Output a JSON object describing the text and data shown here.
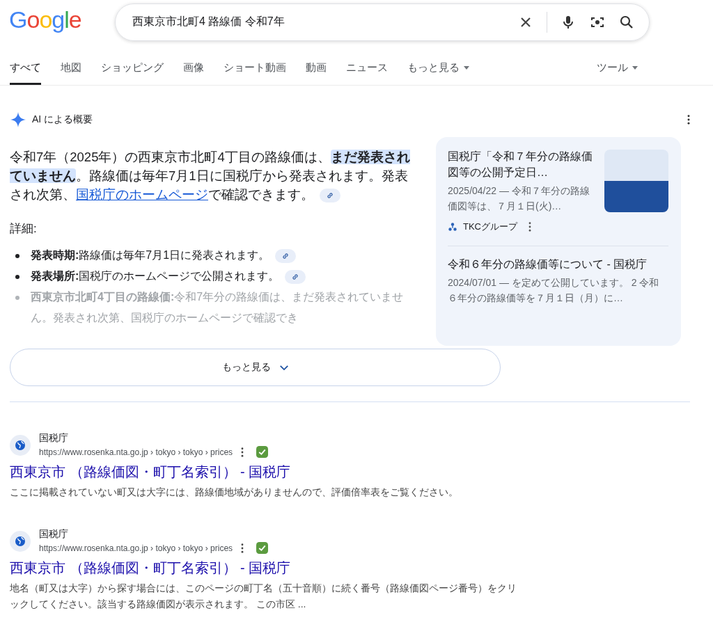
{
  "logo": "Google",
  "search": {
    "value": "西東京市北町4 路線価 令和7年"
  },
  "tabs": [
    {
      "label": "すべて",
      "selected": true,
      "dropdown": false
    },
    {
      "label": "地図",
      "selected": false,
      "dropdown": false
    },
    {
      "label": "ショッピング",
      "selected": false,
      "dropdown": false
    },
    {
      "label": "画像",
      "selected": false,
      "dropdown": false
    },
    {
      "label": "ショート動画",
      "selected": false,
      "dropdown": false
    },
    {
      "label": "動画",
      "selected": false,
      "dropdown": false
    },
    {
      "label": "ニュース",
      "selected": false,
      "dropdown": false
    },
    {
      "label": "もっと見る",
      "selected": false,
      "dropdown": true
    }
  ],
  "tools": {
    "label": "ツール"
  },
  "ai_overview": {
    "title": "AI による概要",
    "paragraph": [
      {
        "kind": "plain",
        "text": "令和7年（2025年）の西東京市北町4丁目の路線価は、"
      },
      {
        "kind": "highlight",
        "text": "まだ発表されていません"
      },
      {
        "kind": "plain",
        "text": "。路線価は毎年7月1日に国税庁から発表されます。発表され次第、"
      },
      {
        "kind": "link",
        "text": "国税庁のホームページ"
      },
      {
        "kind": "plain",
        "text": "で確認できます。"
      }
    ],
    "details_heading": "詳細:",
    "bullets": [
      {
        "label": "発表時期:",
        "text": "路線価は毎年7月1日に発表されます。",
        "faded": false
      },
      {
        "label": "発表場所:",
        "text": "国税庁のホームページで公開されます。",
        "faded": false
      },
      {
        "label": "西東京市北町4丁目の路線価:",
        "text": "令和7年分の路線価は、まだ発表されていません。発表され次第、国税庁のホームページで確認でき",
        "faded": true
      }
    ],
    "sources": [
      {
        "title": "国税庁「令和７年分の路線価図等の公開予定日…",
        "snippet": "2025/04/22 — 令和７年分の路線価図等は、７月１日(火)…",
        "site": "TKCグループ",
        "thumbnail": true
      },
      {
        "title": "令和６年分の路線価等について - 国税庁",
        "snippet": "2024/07/01 — を定めて公開しています。 2 令和６年分の路線価等を７月１日（月）に…",
        "thumbnail": false
      }
    ],
    "more_button": "もっと見る"
  },
  "results": [
    {
      "site": "国税庁",
      "url": "https://www.rosenka.nta.go.jp › tokyo › tokyo › prices",
      "title": "西東京市 （路線価図・町丁名索引） - 国税庁",
      "snippet": "ここに掲載されていない町又は大字には、路線価地域がありませんので、評価倍率表をご覧ください。"
    },
    {
      "site": "国税庁",
      "url": "https://www.rosenka.nta.go.jp › tokyo › tokyo › prices",
      "title": "西東京市 （路線価図・町丁名索引） - 国税庁",
      "snippet": "地名（町又は大字）から探す場合には、このページの町丁名（五十音順）に続く番号（路線価図ページ番号）をクリックしてください。該当する路線価図が表示されます。 この市区 ..."
    }
  ]
}
